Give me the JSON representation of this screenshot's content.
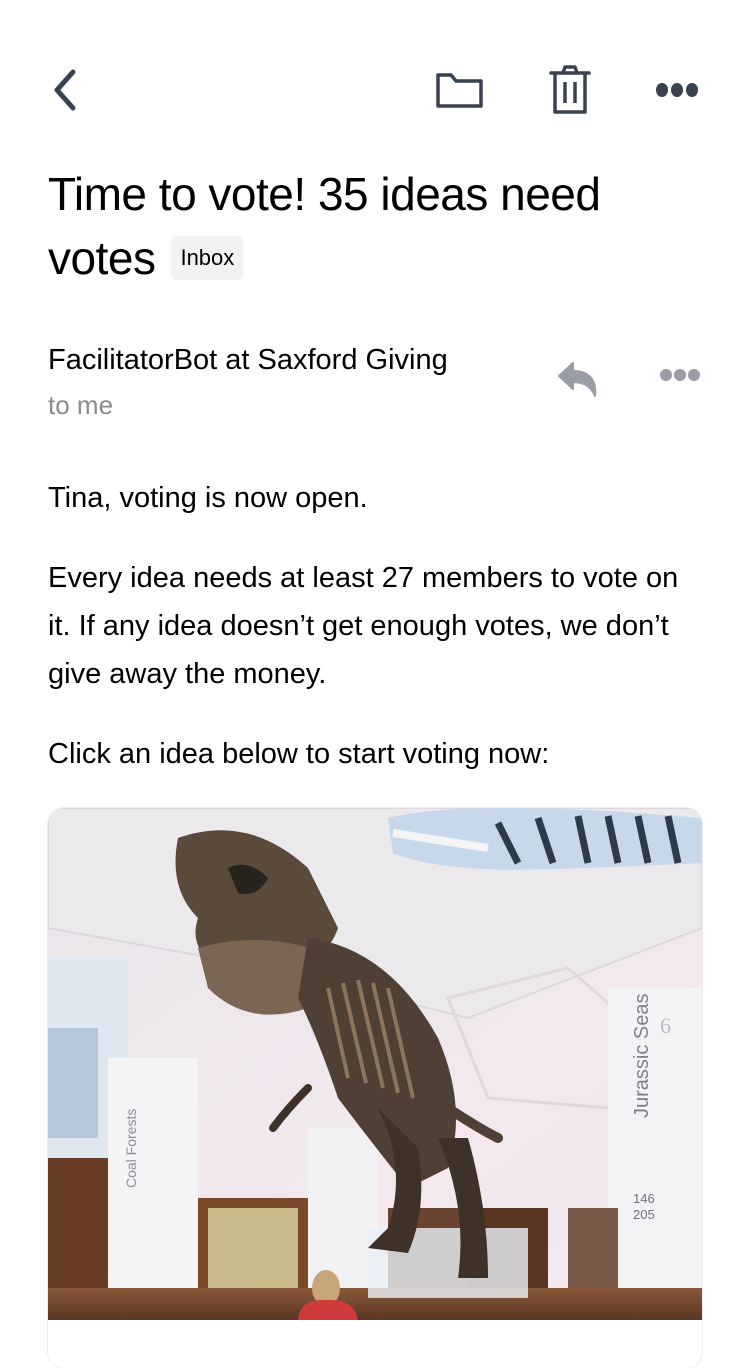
{
  "toolbar": {
    "back_icon": "chevron-left-icon",
    "move_icon": "folder-icon",
    "delete_icon": "trash-icon",
    "more_icon": "more-horizontal-icon",
    "icon_color": "#3a4150"
  },
  "email": {
    "subject": "Time to vote! 35 ideas need votes",
    "label": "Inbox",
    "sender": "FacilitatorBot at Saxford Giving",
    "recipient": "to me",
    "reply_icon": "reply-icon",
    "more_icon": "more-horizontal-icon",
    "secondary_icon_color": "#9a9ca6",
    "body": [
      "Tina, voting is now open.",
      "Every idea needs at least 27 members to vote on it. If any idea doesn’t get enough votes, we don’t give away the money.",
      "Click an idea below to start voting now:"
    ],
    "idea_card": {
      "image_description": "T-rex skeleton hanging in museum hall",
      "sign_labels": [
        "Jurassic Seas",
        "Coal Forests",
        "146",
        "205",
        "6"
      ]
    }
  }
}
